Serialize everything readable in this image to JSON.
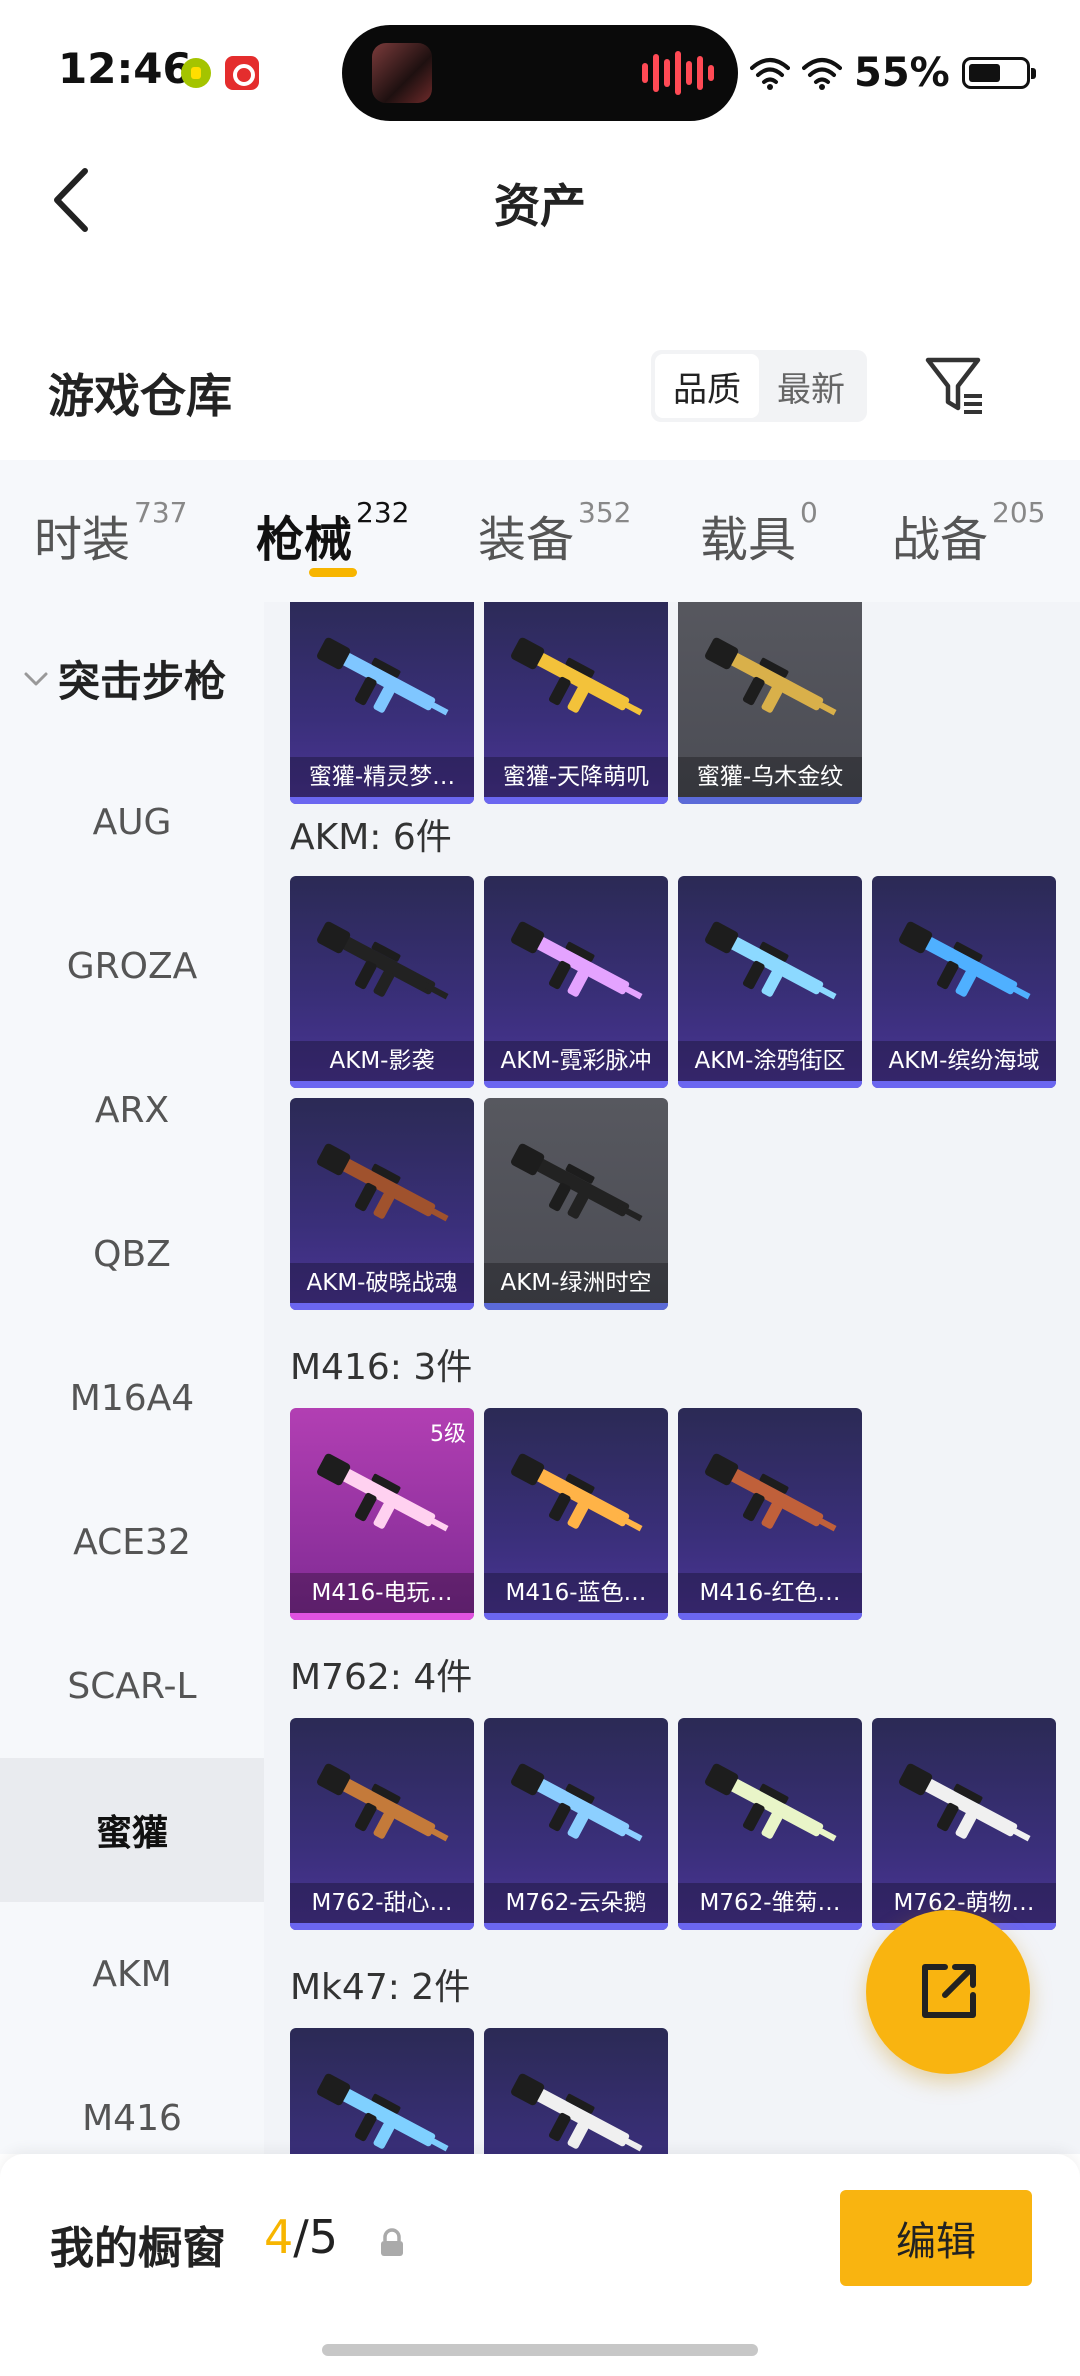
{
  "status_bar": {
    "time": "12:46",
    "battery_percent": "55%",
    "battery_level": 0.55
  },
  "header": {
    "title": "资产"
  },
  "section": {
    "title": "游戏仓库",
    "sort_options": [
      "品质",
      "最新"
    ],
    "sort_active": "品质"
  },
  "tabs": [
    {
      "label": "时装",
      "count": "737"
    },
    {
      "label": "枪械",
      "count": "232",
      "active": true
    },
    {
      "label": "装备",
      "count": "352"
    },
    {
      "label": "载具",
      "count": "0"
    },
    {
      "label": "战备",
      "count": "205"
    }
  ],
  "sidebar": {
    "category": "突击步枪",
    "items": [
      "AUG",
      "GROZA",
      "ARX",
      "QBZ",
      "M16A4",
      "ACE32",
      "SCAR-L",
      "蜜獾",
      "AKM",
      "M416"
    ],
    "active": "蜜獾"
  },
  "groups": [
    {
      "title": "",
      "items": [
        {
          "label": "蜜獾-精灵梦…",
          "rarity": "purple"
        },
        {
          "label": "蜜獾-天降萌叽",
          "rarity": "purple"
        },
        {
          "label": "蜜獾-乌木金纹",
          "rarity": "grey"
        }
      ]
    },
    {
      "title": "AKM: 6件",
      "items": [
        {
          "label": "AKM-影袭",
          "rarity": "purple"
        },
        {
          "label": "AKM-霓彩脉冲",
          "rarity": "purple"
        },
        {
          "label": "AKM-涂鸦街区",
          "rarity": "purple"
        },
        {
          "label": "AKM-缤纷海域",
          "rarity": "purple"
        },
        {
          "label": "AKM-破晓战魂",
          "rarity": "purple"
        },
        {
          "label": "AKM-绿洲时空",
          "rarity": "grey"
        }
      ]
    },
    {
      "title": "M416: 3件",
      "items": [
        {
          "label": "M416-电玩…",
          "rarity": "pink",
          "badge": "5级"
        },
        {
          "label": "M416-蓝色…",
          "rarity": "purple"
        },
        {
          "label": "M416-红色…",
          "rarity": "purple"
        }
      ]
    },
    {
      "title": "M762: 4件",
      "items": [
        {
          "label": "M762-甜心…",
          "rarity": "purple"
        },
        {
          "label": "M762-云朵鹅",
          "rarity": "purple"
        },
        {
          "label": "M762-雏菊…",
          "rarity": "purple"
        },
        {
          "label": "M762-萌物…",
          "rarity": "purple"
        }
      ]
    },
    {
      "title": "Mk47: 2件",
      "items": [
        {
          "label": "",
          "rarity": "purple"
        },
        {
          "label": "",
          "rarity": "purple"
        }
      ]
    }
  ],
  "bottom": {
    "showcase_label": "我的橱窗",
    "showcase_current": "4",
    "showcase_sep": "/",
    "showcase_max": "5",
    "edit_label": "编辑"
  },
  "colors": {
    "accent": "#f9b410",
    "tab_underline": "#f7b500"
  },
  "icons": {
    "back": "chevron-left-icon",
    "filter": "filter-icon",
    "fab": "share-external-icon",
    "lock": "lock-icon",
    "expand": "chevron-down-icon"
  }
}
